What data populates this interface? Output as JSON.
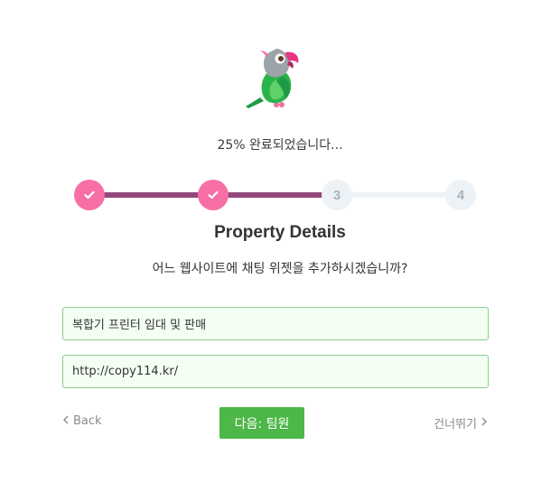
{
  "progress": {
    "text": "25% 완료되었습니다...",
    "percent": 25
  },
  "stepper": {
    "steps": [
      {
        "label": "",
        "state": "done"
      },
      {
        "label": "",
        "state": "done"
      },
      {
        "label": "3",
        "state": "todo"
      },
      {
        "label": "4",
        "state": "todo"
      }
    ]
  },
  "form": {
    "heading": "Property Details",
    "question": "어느 웹사이트에 채팅 위젯을 추가하시겠습니까?",
    "name_field": {
      "value": "복합기 프린터 임대 및 판매"
    },
    "url_field": {
      "value": "http://copy114.kr/"
    }
  },
  "nav": {
    "back_label": "Back",
    "next_label": "다음: 팀원",
    "skip_label": "건너뛰기"
  },
  "colors": {
    "step_done": "#f76fa5",
    "track_done": "#93487c",
    "track_todo": "#edf2f6",
    "next_button": "#4db748",
    "field_bg": "#f3fff3",
    "field_border": "#8bcc8b"
  },
  "icons": {
    "logo": "parrot-logo-icon",
    "step_done": "check-icon",
    "back": "chevron-left-icon",
    "skip": "chevron-right-icon"
  }
}
